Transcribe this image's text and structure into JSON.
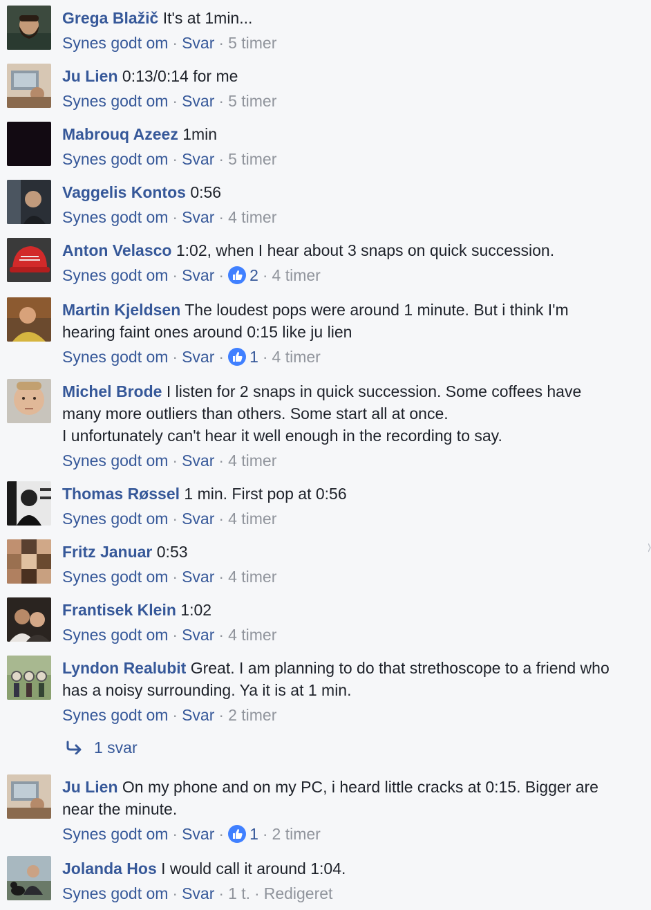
{
  "common": {
    "like": "Synes godt om",
    "reply": "Svar",
    "dot": "·"
  },
  "comments": [
    {
      "author": "Grega Blažič",
      "lines": [
        "It's at 1min..."
      ],
      "reactions": "",
      "time": "5 timer",
      "avatar": "bearded-man-photo"
    },
    {
      "author": "Ju Lien",
      "lines": [
        "0:13/0:14 for me"
      ],
      "reactions": "",
      "time": "5 timer",
      "avatar": "laptop-desk-photo"
    },
    {
      "author": "Mabrouq Azeez",
      "lines": [
        "1min"
      ],
      "reactions": "",
      "time": "5 timer",
      "avatar": "dark-photo"
    },
    {
      "author": "Vaggelis Kontos",
      "lines": [
        "0:56"
      ],
      "reactions": "",
      "time": "4 timer",
      "avatar": "man-in-studio-photo"
    },
    {
      "author": "Anton Velasco",
      "lines": [
        "1:02, when I hear about 3 snaps on quick succession."
      ],
      "reactions": "2",
      "time": "4 timer",
      "avatar": "red-cap-photo"
    },
    {
      "author": "Martin Kjeldsen",
      "lines": [
        "The loudest pops were around 1 minute. But i think I'm",
        "hearing faint ones around 0:15 like ju lien"
      ],
      "reactions": "1",
      "time": "4 timer",
      "avatar": "man-yellow-shirt-photo"
    },
    {
      "author": "Michel Brode",
      "lines": [
        "I listen for 2 snaps in quick succession. Some coffees have",
        "many more outliers than others. Some start all at once.",
        "I unfortunately can't hear it well enough in the recording to say."
      ],
      "reactions": "",
      "time": "4 timer",
      "avatar": "face-closeup-photo"
    },
    {
      "author": "Thomas Røssel",
      "lines": [
        "1 min. First pop at 0:56"
      ],
      "reactions": "",
      "time": "4 timer",
      "avatar": "black-white-photo"
    },
    {
      "author": "Fritz Januar",
      "lines": [
        "0:53"
      ],
      "reactions": "",
      "time": "4 timer",
      "avatar": "group-collage-photo"
    },
    {
      "author": "Frantisek Klein",
      "lines": [
        "1:02"
      ],
      "reactions": "",
      "time": "4 timer",
      "avatar": "couple-photo"
    },
    {
      "author": "Lyndon Realubit",
      "lines": [
        "Great. I am planning to do that strethoscope to a friend who",
        "has a noisy surrounding. Ya it is at 1 min."
      ],
      "reactions": "",
      "time": "2 timer",
      "avatar": "outdoor-group-photo"
    },
    {
      "author": "Ju Lien",
      "lines": [
        "On my phone and on my PC, i heard little cracks at 0:15. Bigger are",
        "near the minute."
      ],
      "reactions": "1",
      "time": "2 timer",
      "avatar": "laptop-desk-photo"
    },
    {
      "author": "Jolanda Hos",
      "lines": [
        "I would call it around 1:04."
      ],
      "reactions": "",
      "time": "1 t.",
      "edited": "Redigeret",
      "avatar": "woman-with-dog-photo"
    }
  ],
  "replies": {
    "label": "1 svar",
    "icon": "reply-arrow-icon"
  },
  "colors": {
    "link": "#365899",
    "meta": "#90949c",
    "text": "#1d2129",
    "background": "#f6f7f9",
    "like_badge": "#4080ff"
  }
}
